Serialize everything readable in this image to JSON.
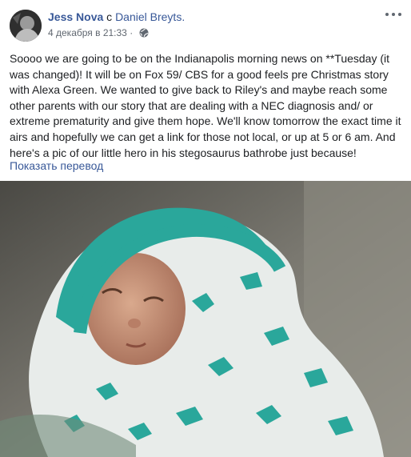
{
  "post": {
    "author": "Jess Nova",
    "with_word": "с",
    "tagged_user": "Daniel Breyts.",
    "timestamp": "4 декабря в 21:33 ·",
    "privacy_icon": "globe-icon",
    "more_icon": "more-options-icon",
    "text": "Soooo we are going to be on the Indianapolis morning news on **Tuesday (it was changed)! It will be on Fox 59/ CBS for a good feels pre Christmas story with Alexa Green. We wanted to give back to Riley's and maybe reach some other parents with our story that are dealing with a NEC diagnosis and/ or extreme prematurity and give them hope. We'll know tomorrow the exact time it airs and hopefully we can get a link for those not local, or up at 5 or 6 am. And here's a pic of our little hero in his stegosaurus bathrobe just because!",
    "translate_link": "Показать перевод"
  },
  "colors": {
    "link": "#385898",
    "text": "#1c1e21",
    "meta": "#606770",
    "robe_teal": "#2aa79b"
  }
}
